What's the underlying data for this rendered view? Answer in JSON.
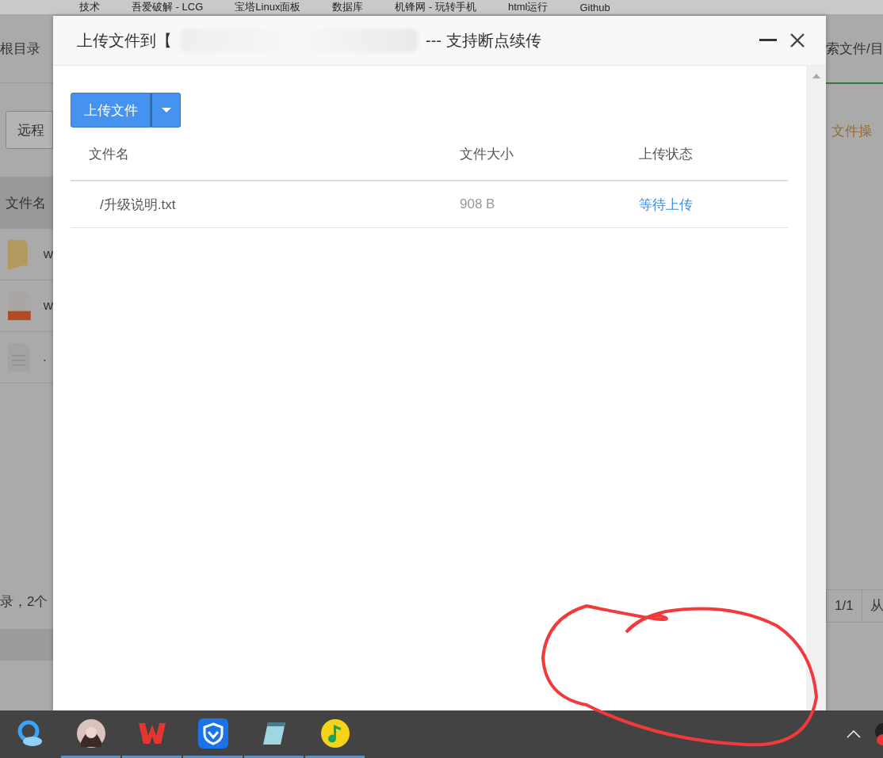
{
  "bookmarks": [
    "技术",
    "吾爱破解 - LCG",
    "宝塔Linux面板",
    "数据库",
    "机锋网 - 玩转手机",
    "html运行",
    "Github"
  ],
  "background": {
    "breadcrumb": "根目录",
    "search": "索文件/目",
    "remote_button": "远程",
    "file_ops": "文件操",
    "column_name": "文件名",
    "rows": [
      {
        "kind": "folder",
        "name": "w"
      },
      {
        "kind": "zip",
        "name": "w"
      },
      {
        "kind": "text",
        "name": "."
      }
    ],
    "summary": "录，2个",
    "pager": "1/1",
    "pager_next": "从"
  },
  "dialog": {
    "title_prefix": "上传文件到【",
    "title_suffix": "--- 支持断点续传",
    "upload_button": "上传文件",
    "columns": [
      "文件名",
      "文件大小",
      "上传状态"
    ],
    "rows": [
      {
        "name": "/升级说明.txt",
        "size": "908 B",
        "status": "等待上传"
      }
    ]
  },
  "taskbar": {
    "apps": [
      {
        "kind": "cloud",
        "active": false
      },
      {
        "kind": "avatar",
        "active": true
      },
      {
        "kind": "office",
        "active": true
      },
      {
        "kind": "shield",
        "active": true
      },
      {
        "kind": "notepad",
        "active": true
      },
      {
        "kind": "music",
        "active": true
      }
    ]
  }
}
